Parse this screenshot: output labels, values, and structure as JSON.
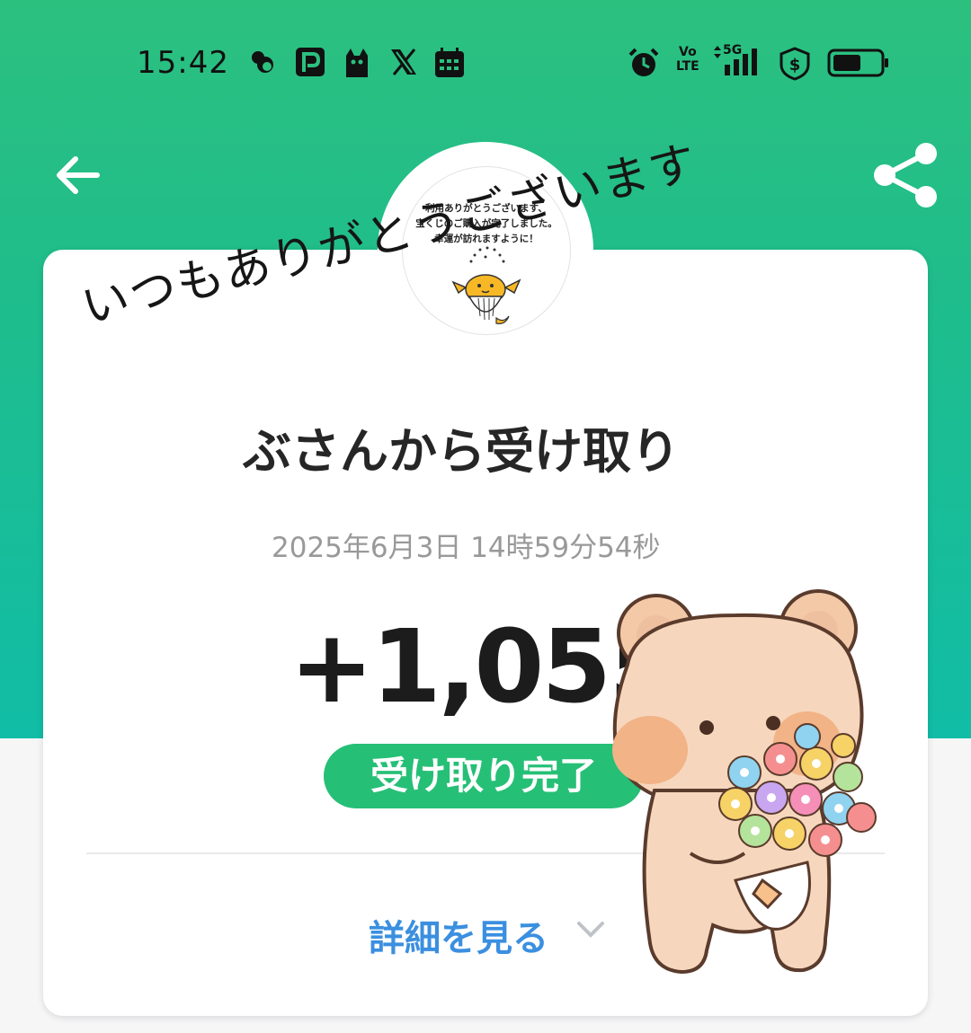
{
  "status_bar": {
    "time": "15:42",
    "notification_icons": [
      "weather-icon",
      "paypay-icon",
      "cat-icon",
      "x-icon",
      "calendar-icon"
    ],
    "system_icons": [
      "alarm-icon",
      "volte-icon",
      "signal-5g-icon",
      "shield-icon",
      "battery-icon"
    ],
    "volte_label_top": "Vo",
    "volte_label_bottom": "LTE",
    "network_label": "5G"
  },
  "header": {
    "back_icon": "arrow-left-icon",
    "share_icon": "share-icon"
  },
  "sticker": {
    "line1": "利用ありがとうございます、",
    "line2": "宝くじのご購入が完了しました。",
    "line3": "幸運が訪れますように！"
  },
  "overlay_text": "いつもありがとうございます",
  "transaction": {
    "title": "ぶさんから受け取り",
    "timestamp": "2025年6月3日 14時59分54秒",
    "amount": "+1,055",
    "status": "受け取り完了"
  },
  "details_link": "詳細を見る",
  "colors": {
    "hero_top": "#2cc07f",
    "hero_bottom": "#11bda6",
    "badge": "#26bf76",
    "link": "#3b8fe0"
  }
}
